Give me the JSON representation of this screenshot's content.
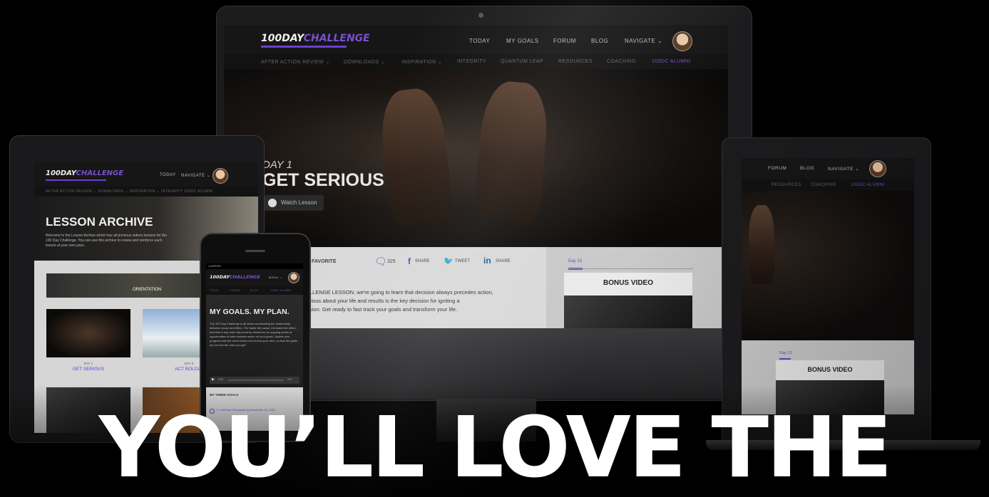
{
  "headline": "YOU’LL LOVE THE",
  "brand": {
    "logo_main": "100DAY",
    "logo_accent": "CHALLENGE"
  },
  "desktop": {
    "nav": {
      "today": "TODAY",
      "my_goals": "MY GOALS",
      "forum": "FORUM",
      "blog": "BLOG",
      "navigate": "NAVIGATE ⌄"
    },
    "subnav": [
      "AFTER ACTION REVIEW ⌄",
      "DOWNLOADS ⌄",
      "INSPIRATION ⌄",
      "INTEGRITY",
      "QUANTUM LEAP",
      "RESOURCES",
      "COACHING",
      "100DC ALUMNI"
    ],
    "hero": {
      "day": "DAY 1",
      "title": "GET SERIOUS",
      "watch": "Watch Lesson"
    },
    "social": {
      "favorite": "FAVORITE",
      "comments": "325",
      "fb_share": "SHARE",
      "tweet": "TWEET",
      "in_share": "SHARE"
    },
    "lesson_text": [
      "LLENGE LESSON, we're going to learn that decision always precedes action,",
      "rious about your life and results is the key decision for igniting a",
      "sion. Get ready to fast track your goals and transform your life."
    ],
    "sidebar": {
      "day_tab": "Day 13",
      "bonus_title": "BONUS VIDEO"
    }
  },
  "laptop": {
    "nav": {
      "forum": "FORUM",
      "blog": "BLOG",
      "navigate": "NAVIGATE ⌄"
    },
    "subnav": [
      "RESOURCES",
      "COACHING",
      "100DC ALUMNI"
    ],
    "sidebar": {
      "day_tab": "Day 13",
      "bonus_title": "BONUS VIDEO"
    }
  },
  "tablet": {
    "nav": {
      "today": "TODAY",
      "navigate": "NAVIGATE ⌄"
    },
    "subnav": "AFTER ACTION REVIEW ⌄   DOWNLOADS ⌄   INSPIRATION ⌄   INTEGRITY   100DC ALUMNI",
    "title": "LESSON ARCHIVE",
    "intro": "Welcome to the Lesson Archive which has all previous videos lessons for the 100 Day Challenge. You can use this archive to review and reinforce each lesson at your own pace.",
    "orientation": "ORIENTATION",
    "cards": [
      {
        "day": "DAY 1",
        "title": "GET SERIOUS"
      },
      {
        "day": "DAY 2",
        "title": "ACT BOLDLY"
      }
    ]
  },
  "phone": {
    "status": "CARRIER",
    "menu": "MENU ⌄",
    "subnav": [
      "TODAY",
      "FORUM",
      "BLOG",
      "100DC ALUMNI"
    ],
    "title": "MY GOALS. MY PLAN.",
    "body": "The 100 Day Challenge is all about accelerating the relationship between cause and effect. The faster the cause, the faster the effect... and that is why each day must be viewed as an ongoing series of opportunities to take massive action on your goals. Update your progress with the forms below and record your wins, so that the goals you set are the ones you get.",
    "audio_start": "0:00",
    "audio_end": "3:21",
    "goals_title": "MY THREE GOALS",
    "goal_1": "1.  I will lose 25 pounds by December 31, 2013"
  },
  "colors": {
    "accent": "#6b3fd1",
    "background": "#000000",
    "headline": "#ffffff"
  },
  "icons": [
    "camera-icon",
    "play-icon",
    "comment-icon",
    "facebook-icon",
    "twitter-icon",
    "linkedin-icon",
    "chevron-down-icon"
  ]
}
